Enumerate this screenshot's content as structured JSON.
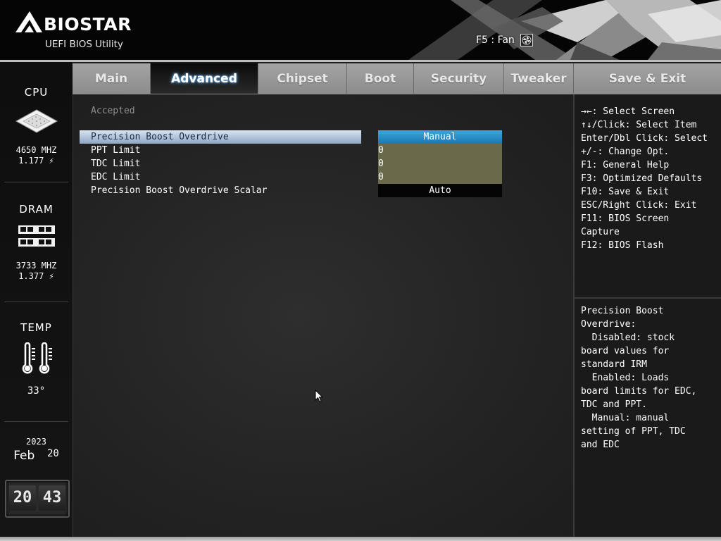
{
  "header": {
    "brand": "BIOSTAR",
    "subtitle": "UEFI BIOS Utility",
    "fan_label": "F5 : Fan"
  },
  "sidebar": {
    "cpu": {
      "title": "CPU",
      "freq": "4650 MHZ",
      "volt": "1.177 ⚡"
    },
    "dram": {
      "title": "DRAM",
      "freq": "3733 MHZ",
      "volt": "1.377 ⚡"
    },
    "temp": {
      "title": "TEMP",
      "value": "33°"
    },
    "date": {
      "year": "2023",
      "month": "Feb",
      "day": "20"
    },
    "clock": {
      "hour": "20",
      "minute": "43"
    }
  },
  "tabs": [
    {
      "label": "Main",
      "active": false
    },
    {
      "label": "Advanced",
      "active": true
    },
    {
      "label": "Chipset",
      "active": false
    },
    {
      "label": "Boot",
      "active": false
    },
    {
      "label": "Security",
      "active": false
    },
    {
      "label": "Tweaker",
      "active": false
    },
    {
      "label": "Save & Exit",
      "active": false
    }
  ],
  "main": {
    "status": "Accepted",
    "rows": [
      {
        "label": "Precision Boost Overdrive",
        "value": "Manual"
      },
      {
        "label": "PPT Limit",
        "value": "0"
      },
      {
        "label": "TDC Limit",
        "value": "0"
      },
      {
        "label": "EDC Limit",
        "value": "0"
      },
      {
        "label": "Precision Boost Overdrive Scalar",
        "value": "Auto"
      }
    ]
  },
  "help": {
    "keys": [
      "→←: Select Screen",
      "↑↓/Click: Select Item",
      "Enter/Dbl Click: Select",
      "+/-: Change Opt.",
      "F1: General Help",
      "F3: Optimized Defaults",
      "F10: Save & Exit",
      "ESC/Right Click: Exit",
      "F11: BIOS Screen",
      "Capture",
      "F12: BIOS Flash"
    ],
    "description": "Precision Boost\nOverdrive:\n  Disabled: stock\nboard values for\nstandard IRM\n  Enabled: Loads\nboard limits for EDC,\nTDC and PPT.\n  Manual: manual\nsetting of PPT, TDC\nand EDC"
  },
  "colors": {
    "selected_value": "#1a78b4",
    "edit_field": "#6a6a4a",
    "tab_inactive": "#9a9a9a",
    "tab_active": "#111111"
  }
}
